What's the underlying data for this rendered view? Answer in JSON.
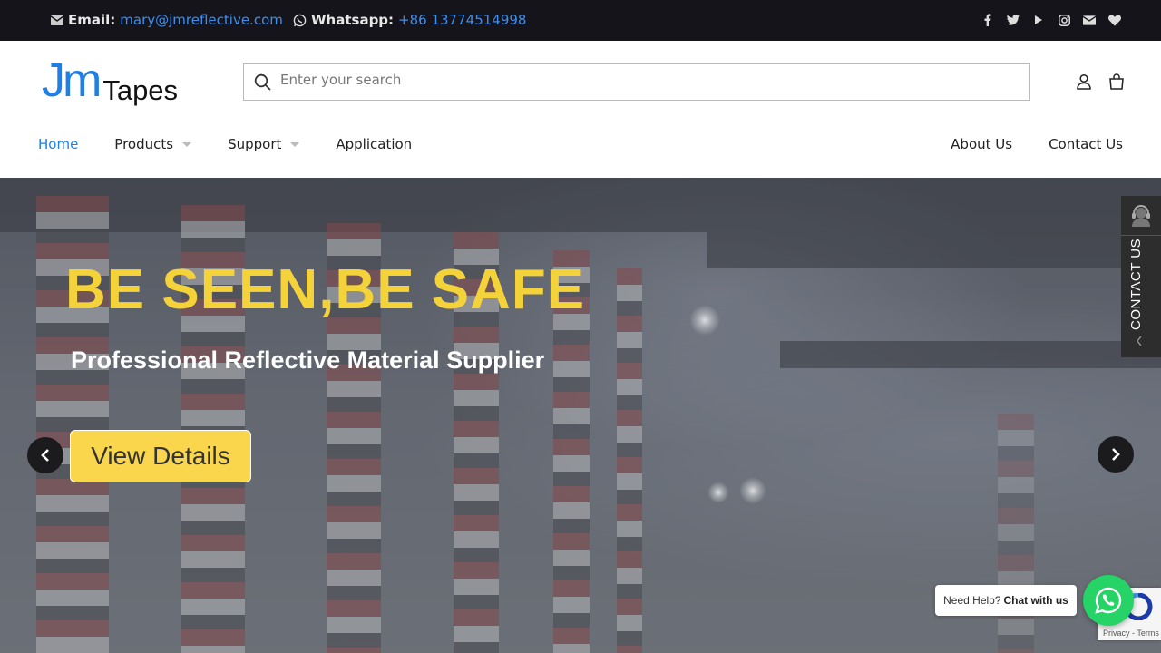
{
  "topbar": {
    "email_label": "Email:",
    "email_value": "mary@jmreflective.com",
    "whatsapp_label": "Whatsapp:",
    "whatsapp_value": "+86 13774514998",
    "social": [
      "facebook-icon",
      "twitter-icon",
      "youtube-icon",
      "instagram-icon",
      "mail-icon",
      "heart-icon"
    ]
  },
  "header": {
    "logo_jm": "Jm",
    "logo_tapes": "Tapes",
    "search_placeholder": "Enter your search"
  },
  "nav": {
    "home": "Home",
    "products": "Products",
    "support": "Support",
    "application": "Application",
    "about": "About Us",
    "contact": "Contact Us"
  },
  "hero": {
    "headline": "BE SEEN,BE SAFE",
    "subheadline": "Professional Reflective Material Supplier",
    "cta_label": "View Details"
  },
  "side_contact": {
    "label": "CONTACT US"
  },
  "chat": {
    "need_help": "Need Help?",
    "chat_with_us": "Chat with us"
  },
  "recaptcha": {
    "terms": "Privacy - Terms"
  },
  "colors": {
    "accent": "#1f7fe6",
    "headline": "#f4d23a",
    "cta": "#f9d64b",
    "whatsapp": "#25d366",
    "topbar": "#14141a"
  }
}
